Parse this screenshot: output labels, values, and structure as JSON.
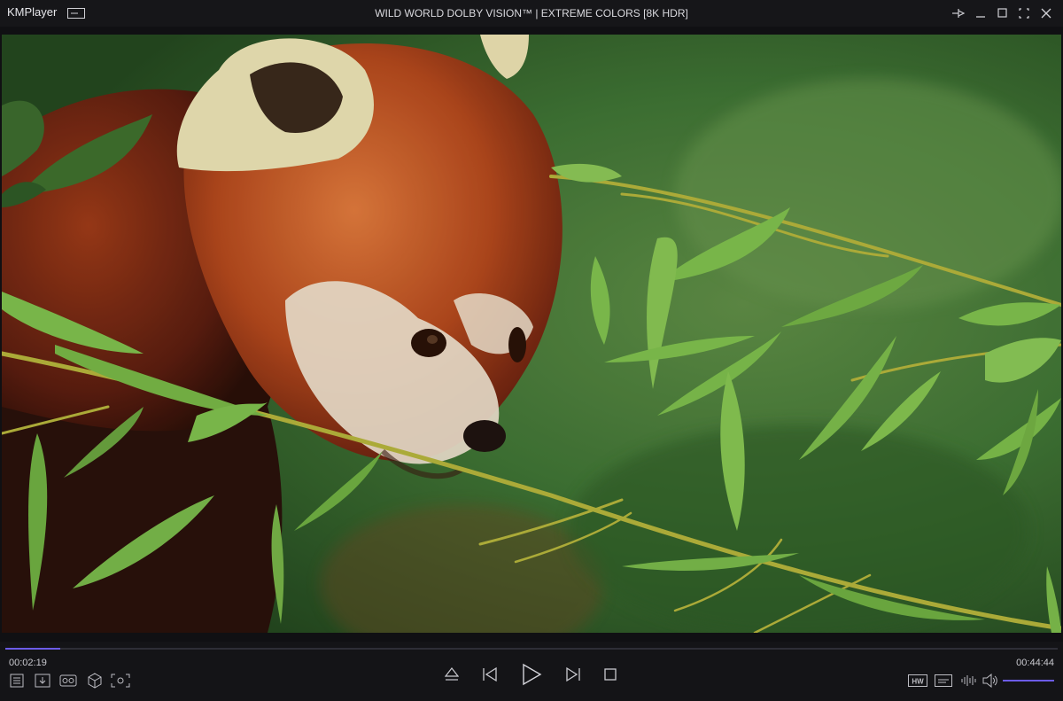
{
  "app": {
    "name": "KMPlayer",
    "title": "WILD WORLD DOLBY VISION™ | EXTREME COLORS [8K HDR]"
  },
  "window_controls": [
    "pin-icon",
    "minimize-icon",
    "maximize-icon",
    "fullscreen-icon",
    "close-icon"
  ],
  "playback": {
    "elapsed": "00:02:19",
    "total": "00:44:44",
    "progress": 0.052
  },
  "left_tools": [
    "playlist-icon",
    "download-icon",
    "vr-icon",
    "3d-cube-icon",
    "screen-capture-icon"
  ],
  "transport": [
    "eject-icon",
    "previous-icon",
    "play-icon",
    "next-icon",
    "stop-icon"
  ],
  "right_tools": {
    "hw_label": "HW",
    "icons": [
      "hw-decoder-icon",
      "subtitle-icon",
      "audio-equalizer-icon",
      "volume-icon"
    ],
    "volume": 1.0
  },
  "colors": {
    "accent": "#6c5ce7",
    "background": "#141417",
    "titlebar": "#161619"
  }
}
